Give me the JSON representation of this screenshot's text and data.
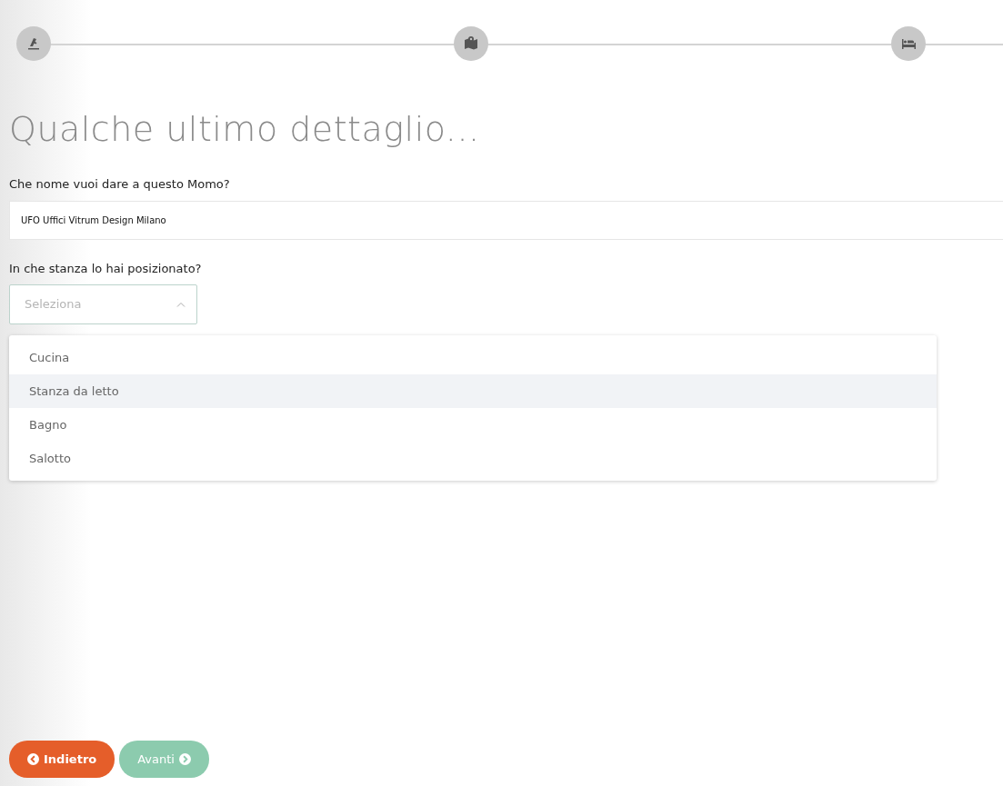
{
  "steps": [
    {
      "kind": "drill",
      "done": true
    },
    {
      "kind": "map",
      "done": true
    },
    {
      "kind": "bed",
      "done": true
    }
  ],
  "title": "Qualche ultimo dettaglio...",
  "name_field": {
    "label": "Che nome vuoi dare a questo Momo?",
    "value": "UFO Uffici Vitrum Design Milano"
  },
  "room_field": {
    "label": "In che stanza lo hai posizionato?",
    "placeholder": "Seleziona",
    "expanded": true,
    "options": [
      {
        "label": "Cucina",
        "highlighted": false
      },
      {
        "label": "Stanza da letto",
        "highlighted": true
      },
      {
        "label": "Bagno",
        "highlighted": false
      },
      {
        "label": "Salotto",
        "highlighted": false
      }
    ]
  },
  "buttons": [
    {
      "kind": "back",
      "label": "Indietro",
      "disabled": false
    },
    {
      "kind": "next",
      "label": "Avanti",
      "disabled": true
    }
  ]
}
